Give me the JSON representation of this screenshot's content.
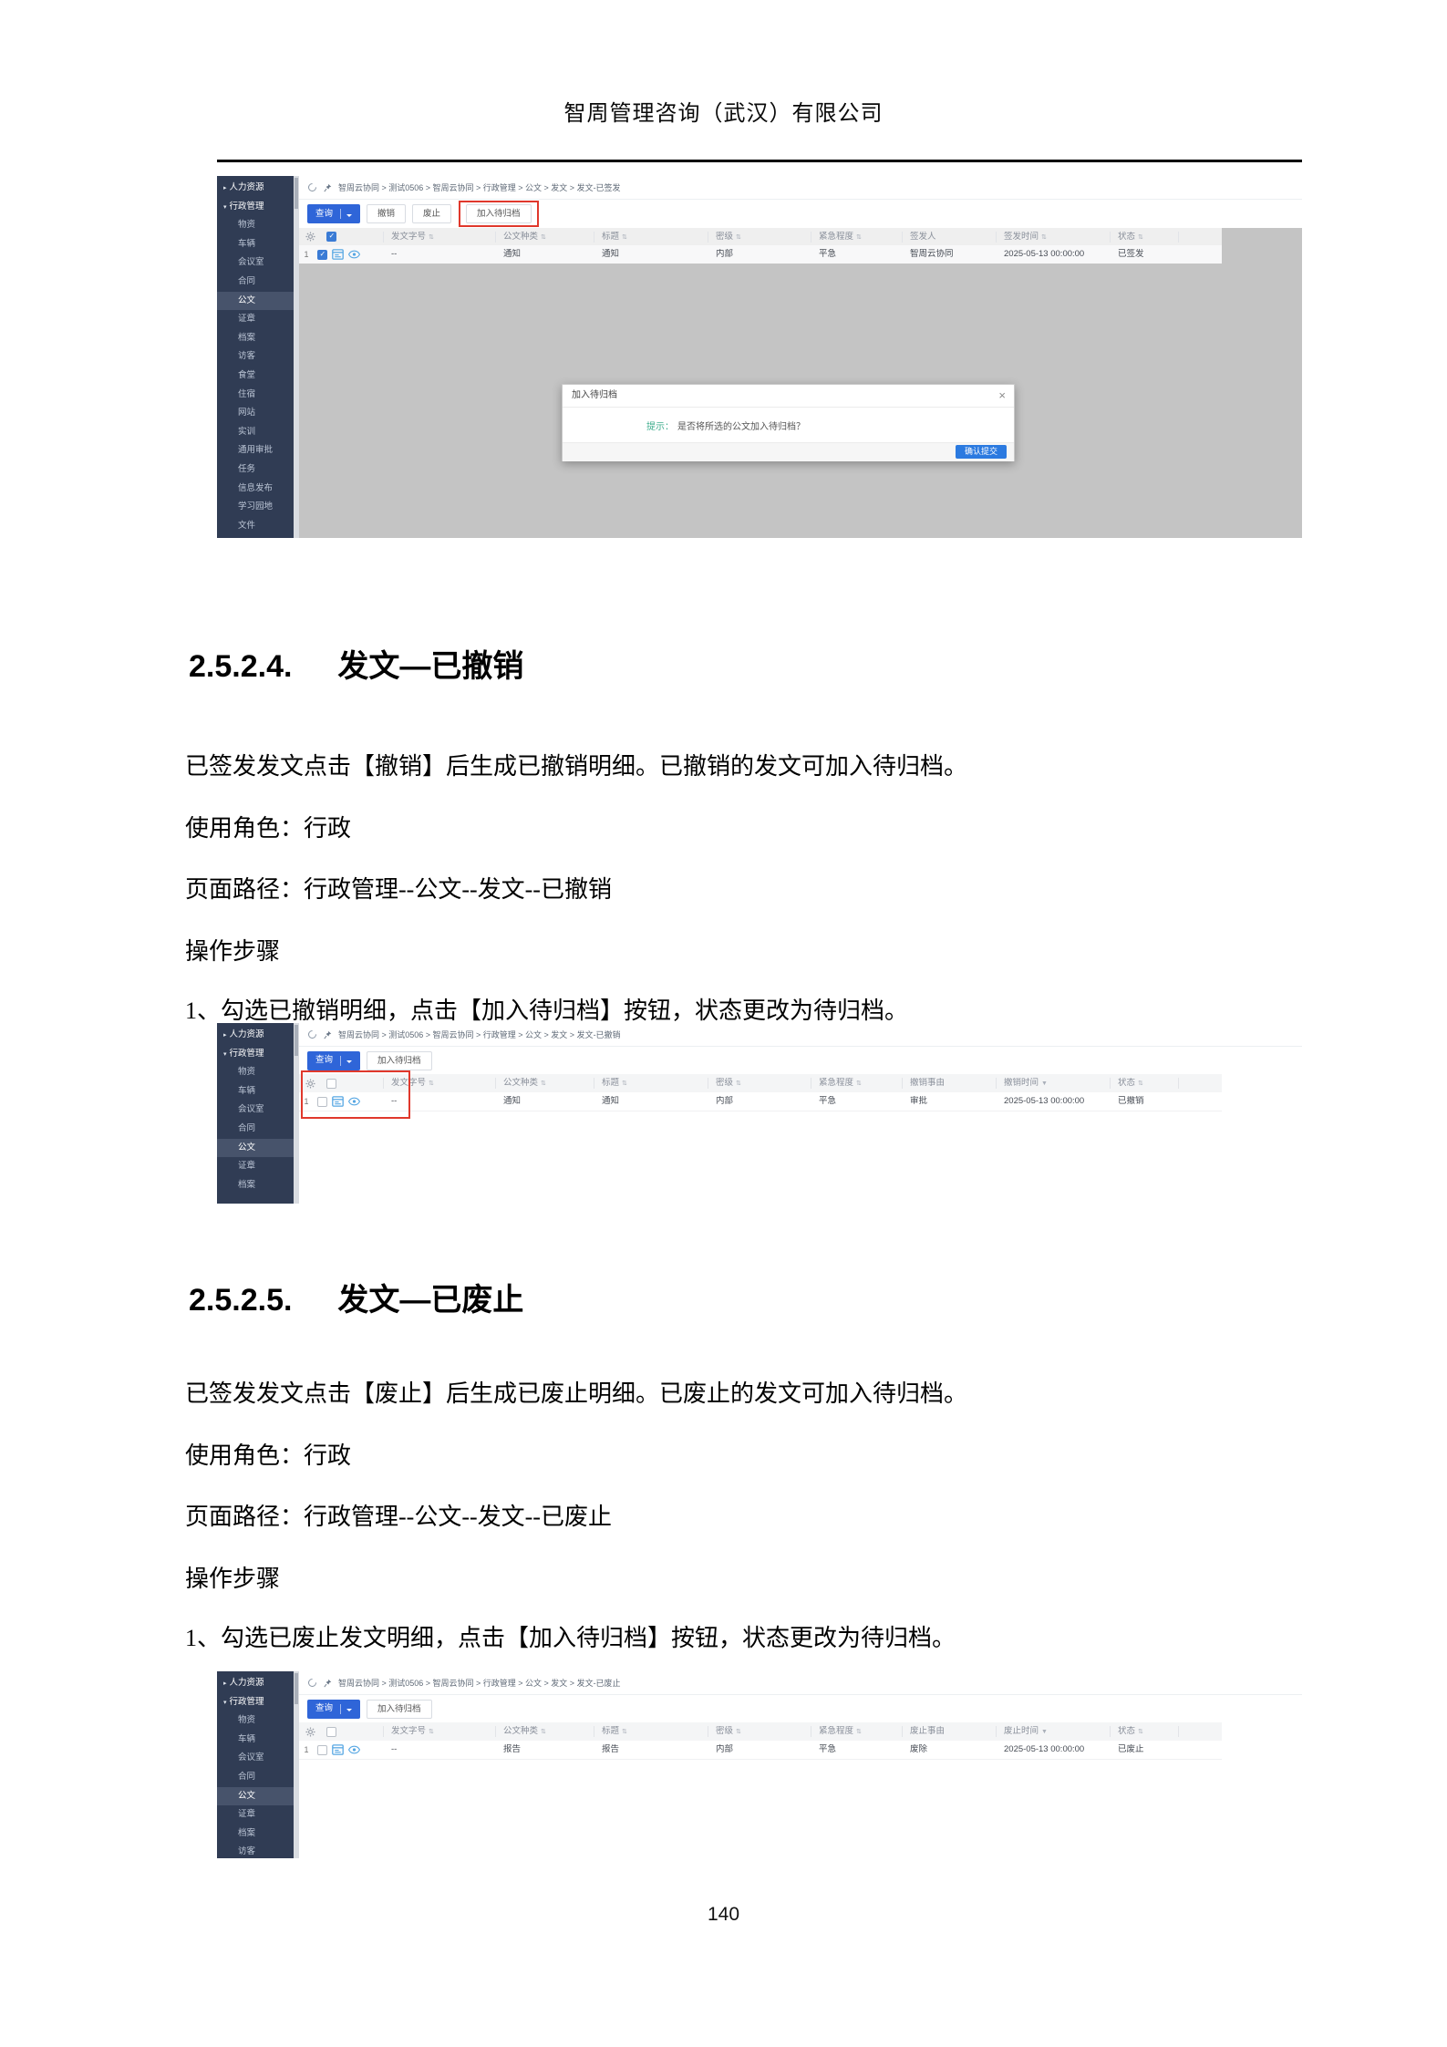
{
  "page": {
    "company_header": "智周管理咨询（武汉）有限公司",
    "page_number": "140"
  },
  "sections": [
    {
      "number": "2.5.2.4.",
      "title": "发文—已撤销",
      "intro": "已签发发文点击【撤销】后生成已撤销明细。已撤销的发文可加入待归档。",
      "role": "使用角色：行政",
      "path": "页面路径：行政管理--公文--发文--已撤销",
      "steps_label": "操作步骤",
      "step1": "1、勾选已撤销明细，点击【加入待归档】按钮，状态更改为待归档。"
    },
    {
      "number": "2.5.2.5.",
      "title": "发文—已废止",
      "intro": "已签发发文点击【废止】后生成已废止明细。已废止的发文可加入待归档。",
      "role": "使用角色：行政",
      "path": "页面路径：行政管理--公文--发文--已废止",
      "steps_label": "操作步骤",
      "step1": "1、勾选已废止发文明细，点击【加入待归档】按钮，状态更改为待归档。"
    }
  ],
  "shots": {
    "s1": {
      "breadcrumb": "智周云协同 > 测试0506 > 智周云协同 > 行政管理 > 公文 > 发文 > 发文-已签发",
      "sidebar": [
        {
          "arrow": "▸",
          "label": "人力资源",
          "cls": "sec"
        },
        {
          "arrow": "▾",
          "label": "行政管理",
          "cls": "sec"
        },
        {
          "arrow": "",
          "label": "物资",
          "cls": ""
        },
        {
          "arrow": "",
          "label": "车辆",
          "cls": ""
        },
        {
          "arrow": "",
          "label": "会议室",
          "cls": ""
        },
        {
          "arrow": "",
          "label": "合同",
          "cls": ""
        },
        {
          "arrow": "",
          "label": "公文",
          "cls": "active"
        },
        {
          "arrow": "",
          "label": "证章",
          "cls": ""
        },
        {
          "arrow": "",
          "label": "档案",
          "cls": ""
        },
        {
          "arrow": "",
          "label": "访客",
          "cls": ""
        },
        {
          "arrow": "",
          "label": "食堂",
          "cls": ""
        },
        {
          "arrow": "",
          "label": "住宿",
          "cls": ""
        },
        {
          "arrow": "",
          "label": "网站",
          "cls": ""
        },
        {
          "arrow": "",
          "label": "实训",
          "cls": ""
        },
        {
          "arrow": "",
          "label": "通用审批",
          "cls": ""
        },
        {
          "arrow": "",
          "label": "任务",
          "cls": ""
        },
        {
          "arrow": "",
          "label": "信息发布",
          "cls": ""
        },
        {
          "arrow": "",
          "label": "学习园地",
          "cls": ""
        },
        {
          "arrow": "",
          "label": "文件",
          "cls": ""
        }
      ],
      "toolbar": {
        "query": "查询",
        "revoke": "撤销",
        "abolish": "废止",
        "archive": "加入待归档"
      },
      "headers": [
        {
          "label": "发文字号",
          "icon": "⇅"
        },
        {
          "label": "公文种类",
          "icon": "⇅"
        },
        {
          "label": "标题",
          "icon": "⇅"
        },
        {
          "label": "密级",
          "icon": "⇅"
        },
        {
          "label": "紧急程度",
          "icon": "⇅"
        },
        {
          "label": "签发人",
          "icon": ""
        },
        {
          "label": "签发时间",
          "icon": "⇅"
        },
        {
          "label": "状态",
          "icon": "⇅"
        },
        {
          "label": "",
          "icon": ""
        }
      ],
      "row": {
        "num": "1",
        "cells": [
          "--",
          "通知",
          "通知",
          "内部",
          "平急",
          "智周云协同",
          "2025-05-13 00:00:00",
          "已签发"
        ]
      },
      "modal": {
        "title": "加入待归档",
        "close": "×",
        "hint_label": "提示：",
        "hint_text": "是否将所选的公文加入待归档？",
        "confirm": "确认提交"
      }
    },
    "s2": {
      "breadcrumb": "智周云协同 > 测试0506 > 智周云协同 > 行政管理 > 公文 > 发文 > 发文-已撤销",
      "sidebar": [
        {
          "arrow": "▸",
          "label": "人力资源",
          "cls": "sec"
        },
        {
          "arrow": "▾",
          "label": "行政管理",
          "cls": "sec"
        },
        {
          "arrow": "",
          "label": "物资",
          "cls": ""
        },
        {
          "arrow": "",
          "label": "车辆",
          "cls": ""
        },
        {
          "arrow": "",
          "label": "会议室",
          "cls": ""
        },
        {
          "arrow": "",
          "label": "合同",
          "cls": ""
        },
        {
          "arrow": "",
          "label": "公文",
          "cls": "active"
        },
        {
          "arrow": "",
          "label": "证章",
          "cls": ""
        },
        {
          "arrow": "",
          "label": "档案",
          "cls": ""
        }
      ],
      "toolbar": {
        "query": "查询",
        "archive": "加入待归档"
      },
      "headers": [
        {
          "label": "发文字号",
          "icon": "⇅"
        },
        {
          "label": "公文种类",
          "icon": "⇅"
        },
        {
          "label": "标题",
          "icon": "⇅"
        },
        {
          "label": "密级",
          "icon": "⇅"
        },
        {
          "label": "紧急程度",
          "icon": "⇅"
        },
        {
          "label": "撤销事由",
          "icon": ""
        },
        {
          "label": "撤销时间",
          "icon": "▼"
        },
        {
          "label": "状态",
          "icon": "⇅"
        },
        {
          "label": "",
          "icon": ""
        }
      ],
      "row": {
        "num": "1",
        "cells": [
          "--",
          "通知",
          "通知",
          "内部",
          "平急",
          "审批",
          "2025-05-13 00:00:00",
          "已撤销"
        ]
      }
    },
    "s3": {
      "breadcrumb": "智周云协同 > 测试0506 > 智周云协同 > 行政管理 > 公文 > 发文 > 发文-已废止",
      "sidebar": [
        {
          "arrow": "▸",
          "label": "人力资源",
          "cls": "sec"
        },
        {
          "arrow": "▾",
          "label": "行政管理",
          "cls": "sec"
        },
        {
          "arrow": "",
          "label": "物资",
          "cls": ""
        },
        {
          "arrow": "",
          "label": "车辆",
          "cls": ""
        },
        {
          "arrow": "",
          "label": "会议室",
          "cls": ""
        },
        {
          "arrow": "",
          "label": "合同",
          "cls": ""
        },
        {
          "arrow": "",
          "label": "公文",
          "cls": "active"
        },
        {
          "arrow": "",
          "label": "证章",
          "cls": ""
        },
        {
          "arrow": "",
          "label": "档案",
          "cls": ""
        },
        {
          "arrow": "",
          "label": "访客",
          "cls": ""
        }
      ],
      "toolbar": {
        "query": "查询",
        "archive": "加入待归档"
      },
      "headers": [
        {
          "label": "发文字号",
          "icon": "⇅"
        },
        {
          "label": "公文种类",
          "icon": "⇅"
        },
        {
          "label": "标题",
          "icon": "⇅"
        },
        {
          "label": "密级",
          "icon": "⇅"
        },
        {
          "label": "紧急程度",
          "icon": "⇅"
        },
        {
          "label": "废止事由",
          "icon": ""
        },
        {
          "label": "废止时间",
          "icon": "▼"
        },
        {
          "label": "状态",
          "icon": "⇅"
        },
        {
          "label": "",
          "icon": ""
        }
      ],
      "row": {
        "num": "1",
        "cells": [
          "--",
          "报告",
          "报告",
          "内部",
          "平急",
          "废除",
          "2025-05-13 00:00:00",
          "已废止"
        ]
      }
    }
  }
}
